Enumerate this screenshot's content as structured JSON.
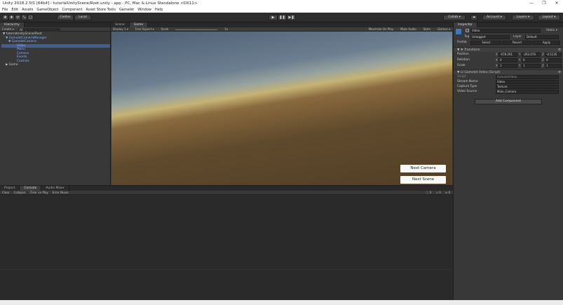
{
  "window": {
    "title": "Unity 2018.2.5f1 [64bit] - tutorialUnityScene/Root.unity - app - PC, Mac & Linux Standalone <DX11>",
    "controls": [
      "—",
      "❐",
      "✕"
    ]
  },
  "menubar": [
    "File",
    "Edit",
    "Assets",
    "GameObject",
    "Component",
    "Asset Store Tools",
    "Gamelet",
    "Window",
    "Help"
  ],
  "toolbar": {
    "tools": [
      "✥",
      "✚",
      "⟳",
      "⤡",
      "▢"
    ],
    "pivot_label": "Center",
    "space_label": "Local",
    "collab_label": "Collab ▾",
    "account_label": "Account ▾",
    "layers_label": "Layers ▾",
    "layout_label": "Layout ▾",
    "play_icons": [
      "▶",
      "❚❚",
      "▶❚"
    ]
  },
  "hierarchy": {
    "tab": "Hierarchy",
    "create_label": "Create ▾",
    "search_placeholder": "All",
    "items": [
      {
        "label": "▼ tutorialUnityScene/Root",
        "indent": 0
      },
      {
        "label": "▼ GameletCameraManager",
        "indent": 1
      },
      {
        "label": "▼ GameletCamera",
        "indent": 2
      },
      {
        "label": "Video",
        "indent": 3
      },
      {
        "label": "Menu",
        "indent": 3
      },
      {
        "label": "Camera",
        "indent": 3
      },
      {
        "label": "Events",
        "indent": 3
      },
      {
        "label": "Controls",
        "indent": 3
      },
      {
        "label": "▶ Game",
        "indent": 1
      }
    ]
  },
  "views": {
    "scene_tab": "Scene",
    "game_tab": "Game",
    "display_label": "Display 1 ▾",
    "aspect_label": "Free Aspect ▾",
    "scale_label": "Scale",
    "scale_value": "1x",
    "right_options": [
      "Maximize On Play",
      "Mute Audio",
      "Stats",
      "Gizmos ▾"
    ],
    "buttons": {
      "next_camera": "Next Camera",
      "next_scene": "Next Scene"
    }
  },
  "bottom_panel": {
    "tabs": [
      "Project",
      "Console",
      "Audio Mixer"
    ],
    "toolbar_items": [
      "Clear",
      "Collapse",
      "Clear on Play",
      "Error Pause"
    ],
    "counts": [
      "0",
      "0",
      "0"
    ]
  },
  "inspector": {
    "tab": "Inspector",
    "object_name": "Video",
    "static_label": "Static ▾",
    "tag_label": "Tag",
    "tag_value": "Untagged",
    "layer_label": "Layer",
    "layer_value": "Default",
    "prefab_label": "Prefab",
    "prefab_buttons": [
      "Select",
      "Revert",
      "Apply"
    ],
    "transform": {
      "header": "Transform",
      "rows": [
        {
          "label": "Position",
          "x": "-678.291",
          "y": "-263.076",
          "z": "-0.5135"
        },
        {
          "label": "Rotation",
          "x": "0",
          "y": "0",
          "z": "0"
        },
        {
          "label": "Scale",
          "x": "1",
          "y": "1",
          "z": "1"
        }
      ]
    },
    "script": {
      "header": "Gamelet Video (Script)",
      "script_label": "Script",
      "script_value": "GameletVideo",
      "fields": [
        {
          "label": "Stream Name",
          "value": "Video"
        },
        {
          "label": "Capture Type",
          "value": "Texture"
        },
        {
          "label": "Video Source",
          "value": "Main_Camera"
        }
      ]
    },
    "add_component_label": "Add Component"
  },
  "colors": {
    "panel": "#383838",
    "dark": "#1f1f1f",
    "accent_blue": "#7fb0ff",
    "selection": "#3e5f96"
  }
}
